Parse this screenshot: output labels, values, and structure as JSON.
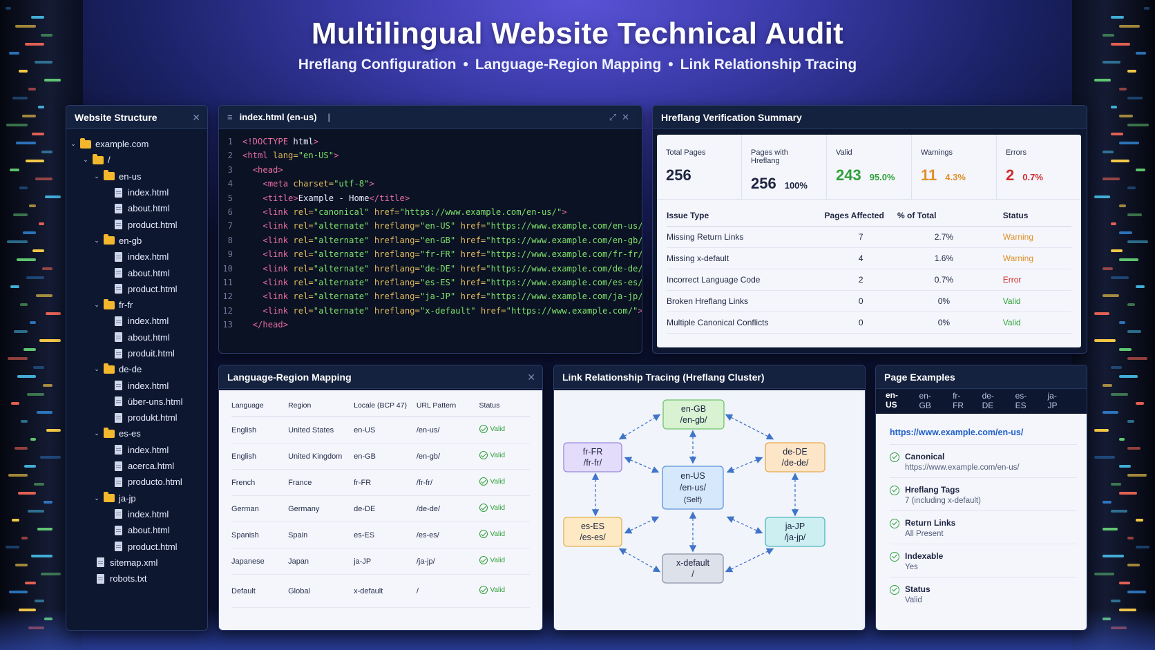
{
  "header": {
    "title": "Multilingual Website Technical Audit",
    "subtitle_items": [
      "Hreflang Configuration",
      "Language-Region Mapping",
      "Link Relationship Tracing"
    ],
    "separator": "•"
  },
  "tree": {
    "title": "Website Structure",
    "root": "example.com",
    "slash": "/",
    "folders": [
      {
        "name": "en-us",
        "files": [
          "index.html",
          "about.html",
          "product.html"
        ]
      },
      {
        "name": "en-gb",
        "files": [
          "index.html",
          "about.html",
          "product.html"
        ]
      },
      {
        "name": "fr-fr",
        "files": [
          "index.html",
          "about.html",
          "produit.html"
        ]
      },
      {
        "name": "de-de",
        "files": [
          "index.html",
          "über-uns.html",
          "produkt.html"
        ]
      },
      {
        "name": "es-es",
        "files": [
          "index.html",
          "acerca.html",
          "producto.html"
        ]
      },
      {
        "name": "ja-jp",
        "files": [
          "index.html",
          "about.html",
          "product.html"
        ]
      }
    ],
    "root_files": [
      "sitemap.xml",
      "robots.txt"
    ]
  },
  "editor": {
    "tab": "index.html (en-us)",
    "lines": [
      {
        "n": "1",
        "html": "<span class=\"tg\">&lt;!DOCTYPE</span> <span class=\"tx\">html</span><span class=\"tg\">&gt;</span>"
      },
      {
        "n": "2",
        "html": "<span class=\"tg\">&lt;html</span> <span class=\"at\">lang=</span><span class=\"vl\">\"en-US\"</span><span class=\"tg\">&gt;</span>"
      },
      {
        "n": "3",
        "html": "  <span class=\"tg\">&lt;head&gt;</span>"
      },
      {
        "n": "4",
        "html": "    <span class=\"tg\">&lt;meta</span> <span class=\"at\">charset=</span><span class=\"vl\">\"utf-8\"</span><span class=\"tg\">&gt;</span>"
      },
      {
        "n": "5",
        "html": "    <span class=\"tg\">&lt;title&gt;</span><span class=\"tx\">Example - Home</span><span class=\"tg\">&lt;/title&gt;</span>"
      },
      {
        "n": "6",
        "html": "    <span class=\"tg\">&lt;link</span> <span class=\"at\">rel=</span><span class=\"vl\">\"canonical\"</span> <span class=\"at\">href=</span><span class=\"vl\">\"https://www.example.com/en-us/\"</span><span class=\"tg\">&gt;</span>"
      },
      {
        "n": "7",
        "html": "    <span class=\"tg\">&lt;link</span> <span class=\"at\">rel=</span><span class=\"vl\">\"alternate\"</span> <span class=\"at\">hreflang=</span><span class=\"vl\">\"en-US\"</span> <span class=\"at\">href=</span><span class=\"vl\">\"https://www.example.com/en-us/\"</span><span class=\"tg\">&gt;</span>"
      },
      {
        "n": "8",
        "html": "    <span class=\"tg\">&lt;link</span> <span class=\"at\">rel=</span><span class=\"vl\">\"alternate\"</span> <span class=\"at\">hreflang=</span><span class=\"vl\">\"en-GB\"</span> <span class=\"at\">href=</span><span class=\"vl\">\"https://www.example.com/en-gb/\"</span><span class=\"tg\">&gt;</span>"
      },
      {
        "n": "9",
        "html": "    <span class=\"tg\">&lt;link</span> <span class=\"at\">rel=</span><span class=\"vl\">\"alternate\"</span> <span class=\"at\">hreflang=</span><span class=\"vl\">\"fr-FR\"</span> <span class=\"at\">href=</span><span class=\"vl\">\"https://www.example.com/fr-fr/\"</span><span class=\"tg\">&gt;</span>"
      },
      {
        "n": "10",
        "html": "    <span class=\"tg\">&lt;link</span> <span class=\"at\">rel=</span><span class=\"vl\">\"alternate\"</span> <span class=\"at\">hreflang=</span><span class=\"vl\">\"de-DE\"</span> <span class=\"at\">href=</span><span class=\"vl\">\"https://www.example.com/de-de/\"</span><span class=\"tg\">&gt;</span>"
      },
      {
        "n": "11",
        "html": "    <span class=\"tg\">&lt;link</span> <span class=\"at\">rel=</span><span class=\"vl\">\"alternate\"</span> <span class=\"at\">hreflang=</span><span class=\"vl\">\"es-ES\"</span> <span class=\"at\">href=</span><span class=\"vl\">\"https://www.example.com/es-es/\"</span><span class=\"tg\">&gt;</span>"
      },
      {
        "n": "12",
        "html": "    <span class=\"tg\">&lt;link</span> <span class=\"at\">rel=</span><span class=\"vl\">\"alternate\"</span> <span class=\"at\">hreflang=</span><span class=\"vl\">\"ja-JP\"</span> <span class=\"at\">href=</span><span class=\"vl\">\"https://www.example.com/ja-jp/\"</span><span class=\"tg\">&gt;</span>"
      },
      {
        "n": "12",
        "html": "    <span class=\"tg\">&lt;link</span> <span class=\"at\">rel=</span><span class=\"vl\">\"alternate\"</span> <span class=\"at\">hreflang=</span><span class=\"vl\">\"x-default\"</span> <span class=\"at\">href=</span><span class=\"vl\">\"https://www.example.com/\"</span><span class=\"tg\">&gt;</span>"
      },
      {
        "n": "13",
        "html": "  <span class=\"tg\">&lt;/head&gt;</span>"
      }
    ]
  },
  "summary": {
    "title": "Hreflang Verification Summary",
    "stats": [
      {
        "label": "Total Pages",
        "value": "256",
        "pct": "",
        "color": "#1d2440"
      },
      {
        "label": "Pages with Hreflang",
        "value": "256",
        "pct": "100%",
        "color": "#1d2440"
      },
      {
        "label": "Valid",
        "value": "243",
        "pct": "95.0%",
        "color": "#2f9f3a"
      },
      {
        "label": "Warnings",
        "value": "11",
        "pct": "4.3%",
        "color": "#e0902a"
      },
      {
        "label": "Errors",
        "value": "2",
        "pct": "0.7%",
        "color": "#d02b2b"
      }
    ],
    "columns": [
      "Issue Type",
      "Pages Affected",
      "% of Total",
      "Status"
    ],
    "rows": [
      {
        "issue": "Missing Return Links",
        "pages": "7",
        "pct": "2.7%",
        "status": "Warning",
        "cls": "warn"
      },
      {
        "issue": "Missing x-default",
        "pages": "4",
        "pct": "1.6%",
        "status": "Warning",
        "cls": "warn"
      },
      {
        "issue": "Incorrect Language Code",
        "pages": "2",
        "pct": "0.7%",
        "status": "Error",
        "cls": "err"
      },
      {
        "issue": "Broken Hreflang Links",
        "pages": "0",
        "pct": "0%",
        "status": "Valid",
        "cls": "ok"
      },
      {
        "issue": "Multiple Canonical Conflicts",
        "pages": "0",
        "pct": "0%",
        "status": "Valid",
        "cls": "ok"
      }
    ]
  },
  "mapping": {
    "title": "Language-Region Mapping",
    "columns": [
      "Language",
      "Region",
      "Locale (BCP 47)",
      "URL Pattern",
      "Status"
    ],
    "rows": [
      [
        "English",
        "United States",
        "en-US",
        "/en-us/",
        "Valid"
      ],
      [
        "English",
        "United Kingdom",
        "en-GB",
        "/en-gb/",
        "Valid"
      ],
      [
        "French",
        "France",
        "fr-FR",
        "/fr-fr/",
        "Valid"
      ],
      [
        "German",
        "Germany",
        "de-DE",
        "/de-de/",
        "Valid"
      ],
      [
        "Spanish",
        "Spain",
        "es-ES",
        "/es-es/",
        "Valid"
      ],
      [
        "Japanese",
        "Japan",
        "ja-JP",
        "/ja-jp/",
        "Valid"
      ],
      [
        "Default",
        "Global",
        "x-default",
        "/",
        "Valid"
      ]
    ]
  },
  "cluster": {
    "title": "Link Relationship Tracing (Hreflang Cluster)",
    "nodes": [
      {
        "id": "engb",
        "l1": "en-GB",
        "l2": "/en-gb/",
        "l3": "",
        "fill": "#d8f2d2",
        "stroke": "#72c46a"
      },
      {
        "id": "frfr",
        "l1": "fr-FR",
        "l2": "/fr-fr/",
        "l3": "",
        "fill": "#e3dcfa",
        "stroke": "#9a87dd"
      },
      {
        "id": "dede",
        "l1": "de-DE",
        "l2": "/de-de/",
        "l3": "",
        "fill": "#fde6c8",
        "stroke": "#e8a84c"
      },
      {
        "id": "enus",
        "l1": "en-US",
        "l2": "/en-us/",
        "l3": "(Self)",
        "fill": "#d6e8fb",
        "stroke": "#5c93d8"
      },
      {
        "id": "eses",
        "l1": "es-ES",
        "l2": "/es-es/",
        "l3": "",
        "fill": "#fde9c4",
        "stroke": "#e6b04c"
      },
      {
        "id": "jajp",
        "l1": "ja-JP",
        "l2": "/ja-jp/",
        "l3": "",
        "fill": "#cdeff2",
        "stroke": "#4fb7c0"
      },
      {
        "id": "xdef",
        "l1": "x-default",
        "l2": "/",
        "l3": "",
        "fill": "#dde1ea",
        "stroke": "#8d95aa"
      }
    ]
  },
  "examples": {
    "title": "Page Examples",
    "tabs": [
      "en-US",
      "en-GB",
      "fr-FR",
      "de-DE",
      "es-ES",
      "ja-JP"
    ],
    "url": "https://www.example.com/en-us/",
    "items": [
      {
        "t": "Canonical",
        "v": "https://www.example.com/en-us/"
      },
      {
        "t": "Hreflang Tags",
        "v": "7 (including x-default)"
      },
      {
        "t": "Return Links",
        "v": "All Present"
      },
      {
        "t": "Indexable",
        "v": "Yes"
      },
      {
        "t": "Status",
        "v": "Valid"
      }
    ]
  }
}
